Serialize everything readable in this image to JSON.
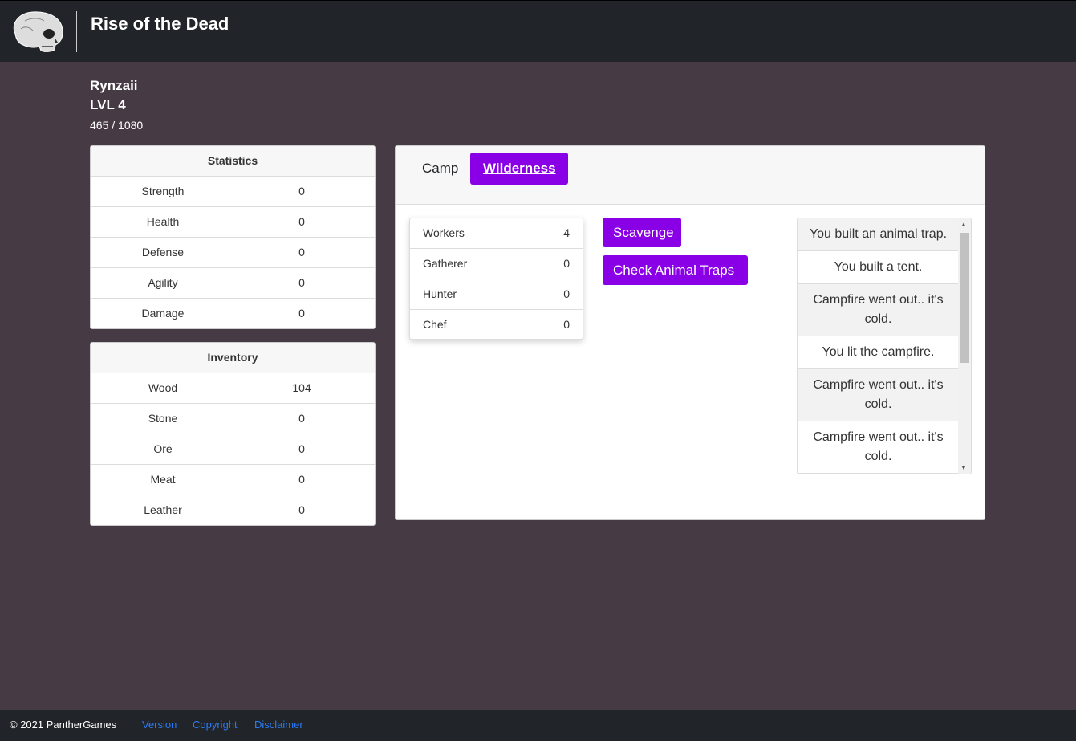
{
  "app": {
    "title": "Rise of the Dead"
  },
  "player": {
    "name": "Rynzaii",
    "level": "LVL 4",
    "xp": "465 / 1080"
  },
  "statistics": {
    "title": "Statistics",
    "rows": [
      {
        "label": "Strength",
        "value": "0"
      },
      {
        "label": "Health",
        "value": "0"
      },
      {
        "label": "Defense",
        "value": "0"
      },
      {
        "label": "Agility",
        "value": "0"
      },
      {
        "label": "Damage",
        "value": "0"
      }
    ]
  },
  "inventory": {
    "title": "Inventory",
    "rows": [
      {
        "label": "Wood",
        "value": "104"
      },
      {
        "label": "Stone",
        "value": "0"
      },
      {
        "label": "Ore",
        "value": "0"
      },
      {
        "label": "Meat",
        "value": "0"
      },
      {
        "label": "Leather",
        "value": "0"
      }
    ]
  },
  "tabs": [
    {
      "label": "Camp",
      "active": false
    },
    {
      "label": "Wilderness",
      "active": true
    }
  ],
  "workers": [
    {
      "label": "Workers",
      "value": "4"
    },
    {
      "label": "Gatherer",
      "value": "0"
    },
    {
      "label": "Hunter",
      "value": "0"
    },
    {
      "label": "Chef",
      "value": "0"
    }
  ],
  "actions": {
    "scavenge": "Scavenge",
    "traps": "Check Animal Traps"
  },
  "log": [
    "You built an animal trap.",
    "You built a tent.",
    "Campfire went out.. it's cold.",
    "You lit the campfire.",
    "Campfire went out.. it's cold.",
    "Campfire went out.. it's cold."
  ],
  "footer": {
    "copyright": "© 2021 PantherGames",
    "links": [
      "Version",
      "Copyright",
      "Disclaimer"
    ]
  },
  "colors": {
    "accent": "#8a00e6",
    "background": "#463a44",
    "navbar": "#212529",
    "link": "#2b7bf5"
  }
}
